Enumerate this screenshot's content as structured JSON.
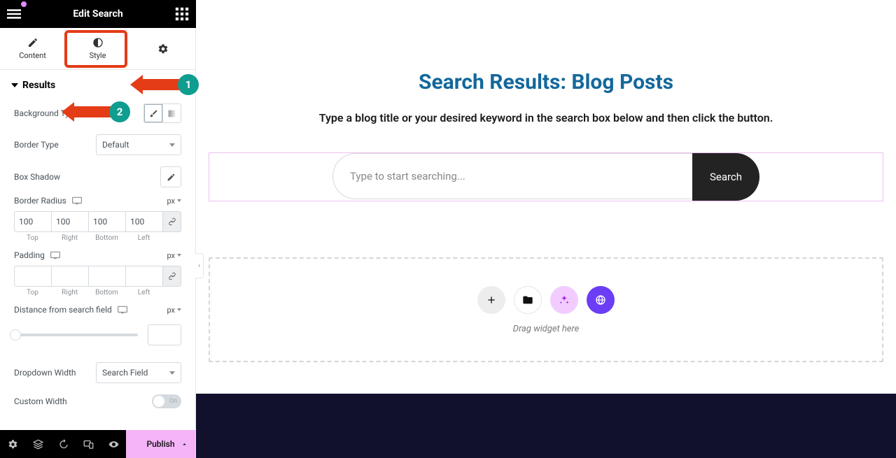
{
  "topbar": {
    "title": "Edit Search"
  },
  "tabs": {
    "content": "Content",
    "style": "Style"
  },
  "section": {
    "results": "Results"
  },
  "controls": {
    "backgroundType": "Background Type",
    "borderType": "Border Type",
    "borderTypeValue": "Default",
    "boxShadow": "Box Shadow",
    "borderRadius": "Border Radius",
    "padding": "Padding",
    "distance": "Distance from search field",
    "dropdownWidth": "Dropdown Width",
    "dropdownWidthValue": "Search Field",
    "customWidth": "Custom Width",
    "unit": "px",
    "toggle": "On"
  },
  "radius": {
    "top": "100",
    "right": "100",
    "bottom": "100",
    "left": "100"
  },
  "dimLabels": {
    "top": "Top",
    "right": "Right",
    "bottom": "Bottom",
    "left": "Left"
  },
  "footer": {
    "publish": "Publish"
  },
  "badges": {
    "one": "1",
    "two": "2"
  },
  "page": {
    "heading": "Search Results: Blog Posts",
    "sub": "Type a blog title or your desired keyword in the search box below and then click the button.",
    "placeholder": "Type to start searching...",
    "searchBtn": "Search",
    "dragText": "Drag widget here"
  }
}
